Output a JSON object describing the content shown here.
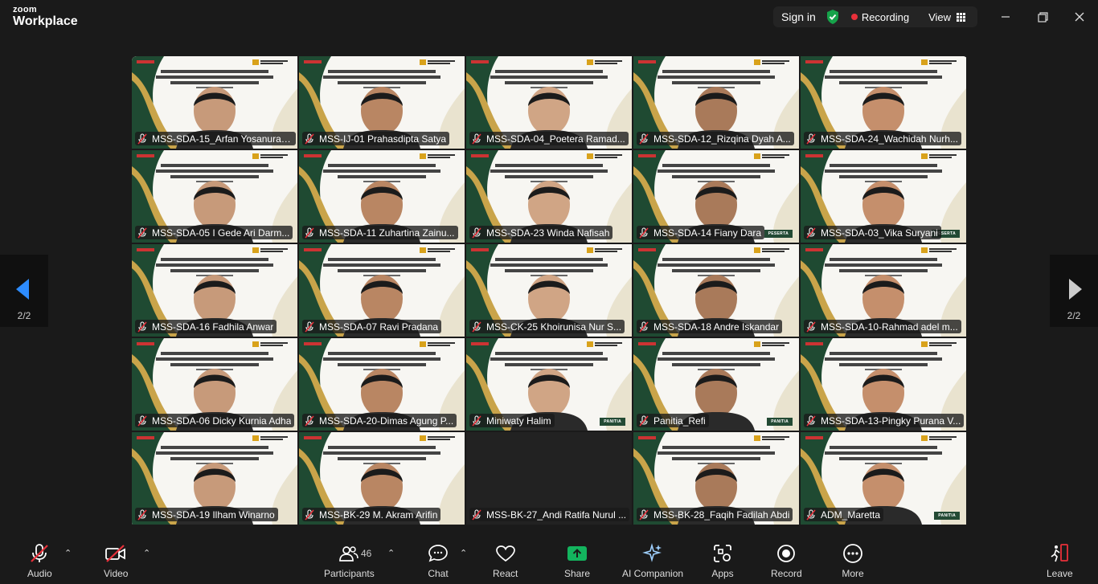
{
  "brand": {
    "small": "zoom",
    "big": "Workplace"
  },
  "titlebar": {
    "sign_in": "Sign in",
    "recording": "Recording",
    "view": "View"
  },
  "tiles": [
    {
      "name": "MSS-SDA-15_Arfan Yosanurah...",
      "badge": ""
    },
    {
      "name": "MSS-IJ-01 Prahasdipta Satya",
      "badge": ""
    },
    {
      "name": "MSS-SDA-04_Poetera Ramad...",
      "badge": ""
    },
    {
      "name": "MSS-SDA-12_Rizqina Dyah A...",
      "badge": ""
    },
    {
      "name": "MSS-SDA-24_Wachidah Nurh...",
      "badge": ""
    },
    {
      "name": "MSS-SDA-05 I Gede Ari Darm...",
      "badge": ""
    },
    {
      "name": "MSS-SDA-11 Zuhartina Zainu...",
      "badge": ""
    },
    {
      "name": "MSS-SDA-23 Winda Nafisah",
      "badge": ""
    },
    {
      "name": "MSS-SDA-14 Fiany Dara",
      "badge": "PESERTA"
    },
    {
      "name": "MSS-SDA-03_Vika Suryani",
      "badge": "PESERTA"
    },
    {
      "name": "MSS-SDA-16 Fadhila Anwar",
      "badge": ""
    },
    {
      "name": "MSS-SDA-07 Ravi Pradana",
      "badge": ""
    },
    {
      "name": "MSS-CK-25 Khoirunisa Nur S...",
      "badge": ""
    },
    {
      "name": "MSS-SDA-18 Andre Iskandar",
      "badge": ""
    },
    {
      "name": "MSS-SDA-10-Rahmad adel m...",
      "badge": ""
    },
    {
      "name": "MSS-SDA-06 Dicky Kurnia Adha",
      "badge": ""
    },
    {
      "name": "MSS-SDA-20-Dimas Agung P...",
      "badge": ""
    },
    {
      "name": "Miniwaty Halim",
      "badge": "PANITIA"
    },
    {
      "name": "Panitia_Refi",
      "badge": "PANITIA"
    },
    {
      "name": "MSS-SDA-13-Pingky Purana V...",
      "badge": ""
    },
    {
      "name": "MSS-SDA-19 Ilham Winarno",
      "badge": ""
    },
    {
      "name": "MSS-BK-29 M. Akram Arifin",
      "badge": ""
    },
    {
      "name": "MSS-BK-27_Andi Ratifa Nurul ...",
      "badge": ""
    },
    {
      "name": "MSS-BK-28_Faqih Fadilah Abdi",
      "badge": ""
    },
    {
      "name": "ADM_Maretta",
      "badge": "PANITIA"
    }
  ],
  "pager": {
    "left": "2/2",
    "right": "2/2"
  },
  "toolbar": {
    "audio": "Audio",
    "video": "Video",
    "participants": "Participants",
    "participants_count": "46",
    "chat": "Chat",
    "react": "React",
    "share": "Share",
    "ai": "AI Companion",
    "apps": "Apps",
    "record": "Record",
    "more": "More",
    "leave": "Leave"
  },
  "colors": {
    "share_green": "#13b45e",
    "record_red": "#e8303a",
    "shield_green": "#16a34a",
    "muted_red": "#e8303a"
  }
}
